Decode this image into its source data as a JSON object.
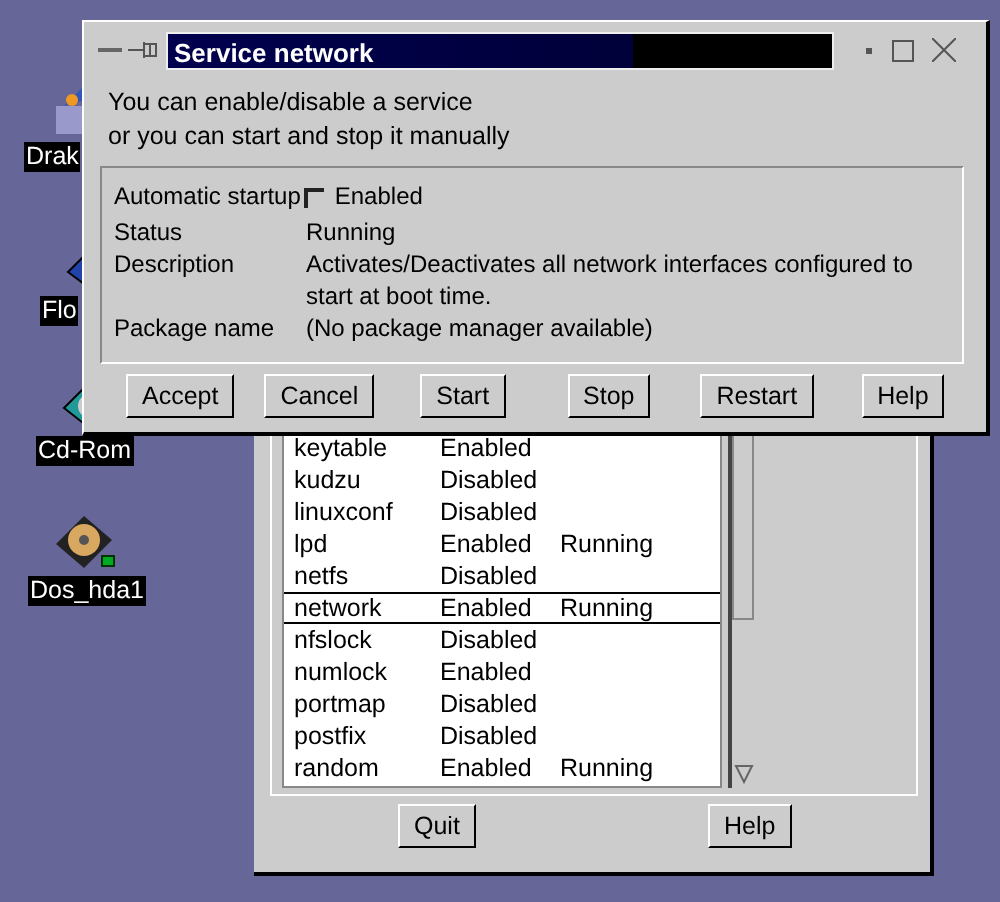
{
  "desktop_icons": [
    {
      "label": "Drak",
      "kind": "drak"
    },
    {
      "label": "Flo",
      "kind": "floppy"
    },
    {
      "label": "Cd-Rom",
      "kind": "cdrom"
    },
    {
      "label": "Dos_hda1",
      "kind": "disk"
    }
  ],
  "services_window": {
    "rows": [
      {
        "name": "keytable",
        "startup": "Enabled",
        "status": "",
        "selected": false
      },
      {
        "name": "kudzu",
        "startup": "Disabled",
        "status": "",
        "selected": false
      },
      {
        "name": "linuxconf",
        "startup": "Disabled",
        "status": "",
        "selected": false
      },
      {
        "name": "lpd",
        "startup": "Enabled",
        "status": "Running",
        "selected": false
      },
      {
        "name": "netfs",
        "startup": "Disabled",
        "status": "",
        "selected": false
      },
      {
        "name": "network",
        "startup": "Enabled",
        "status": "Running",
        "selected": true
      },
      {
        "name": "nfslock",
        "startup": "Disabled",
        "status": "",
        "selected": false
      },
      {
        "name": "numlock",
        "startup": "Enabled",
        "status": "",
        "selected": false
      },
      {
        "name": "portmap",
        "startup": "Disabled",
        "status": "",
        "selected": false
      },
      {
        "name": "postfix",
        "startup": "Disabled",
        "status": "",
        "selected": false
      },
      {
        "name": "random",
        "startup": "Enabled",
        "status": "Running",
        "selected": false
      }
    ],
    "buttons": [
      "Quit",
      "Help"
    ]
  },
  "dialog": {
    "title": "Service network",
    "intro": [
      "You can enable/disable a service",
      "or you can start and stop it manually"
    ],
    "automatic_startup": {
      "label": "Automatic startup",
      "option": "Enabled",
      "checked": false
    },
    "fields": [
      {
        "label": "Status",
        "value": "Running"
      },
      {
        "label": "Description",
        "value": "Activates/Deactivates all network interfaces configured to start at boot time."
      },
      {
        "label": "Package name",
        "value": "(No package manager available)"
      }
    ],
    "buttons": [
      "Accept",
      "Cancel",
      "Start",
      "Stop",
      "Restart",
      "Help"
    ]
  }
}
